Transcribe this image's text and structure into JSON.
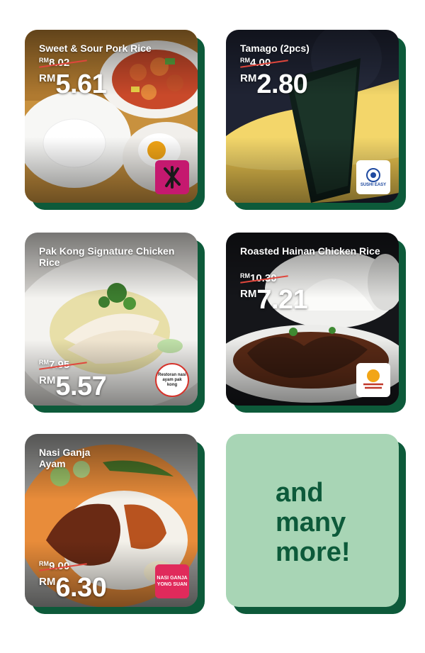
{
  "cards": [
    {
      "title": "Sweet & Sour Pork Rice",
      "old_currency": "RM",
      "old_price": "8.02",
      "new_currency": "RM",
      "new_price": "5.61"
    },
    {
      "title": "Tamago (2pcs)",
      "old_currency": "RM",
      "old_price": "4.00",
      "new_currency": "RM",
      "new_price": "2.80",
      "logo_text": "SUSHI EASY"
    },
    {
      "title": "Pak Kong Signature Chicken Rice",
      "old_currency": "RM",
      "old_price": "7.95",
      "new_currency": "RM",
      "new_price": "5.57",
      "logo_text": "Restoran nasi ayam pak kong"
    },
    {
      "title": "Roasted Hainan Chicken Rice",
      "old_currency": "RM",
      "old_price": "10.30",
      "new_currency": "RM",
      "new_price": "7.21"
    },
    {
      "title": "Nasi Ganja Ayam",
      "old_currency": "RM",
      "old_price": "9.00",
      "new_currency": "RM",
      "new_price": "6.30",
      "logo_text": "NASI GANJA YONG SUAN"
    }
  ],
  "more": {
    "text": "and many more!"
  },
  "colors": {
    "shadow": "#0d5a3a",
    "more_bg": "#a8d5b5",
    "strike": "#e0463c"
  }
}
